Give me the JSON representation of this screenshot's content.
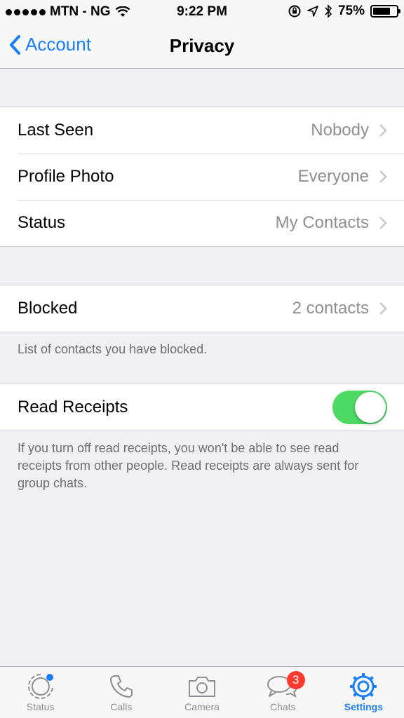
{
  "status_bar": {
    "carrier": "MTN - NG",
    "time": "9:22 PM",
    "battery": "75%",
    "battery_level": 0.75
  },
  "nav": {
    "back_label": "Account",
    "title": "Privacy"
  },
  "privacy_rows": [
    {
      "label": "Last Seen",
      "value": "Nobody"
    },
    {
      "label": "Profile Photo",
      "value": "Everyone"
    },
    {
      "label": "Status",
      "value": "My Contacts"
    }
  ],
  "blocked": {
    "label": "Blocked",
    "value": "2 contacts",
    "footer": "List of contacts you have blocked."
  },
  "read_receipts": {
    "label": "Read Receipts",
    "enabled": true,
    "footer": "If you turn off read receipts, you won't be able to see read receipts from other people. Read receipts are always sent for group chats."
  },
  "tabs": [
    {
      "label": "Status",
      "icon": "status-icon"
    },
    {
      "label": "Calls",
      "icon": "phone-icon"
    },
    {
      "label": "Camera",
      "icon": "camera-icon"
    },
    {
      "label": "Chats",
      "icon": "chats-icon",
      "badge": "3"
    },
    {
      "label": "Settings",
      "icon": "gear-icon",
      "active": true
    }
  ],
  "colors": {
    "accent": "#1a7ef7",
    "toggle_on": "#4cd964",
    "badge": "#ff3b30"
  }
}
